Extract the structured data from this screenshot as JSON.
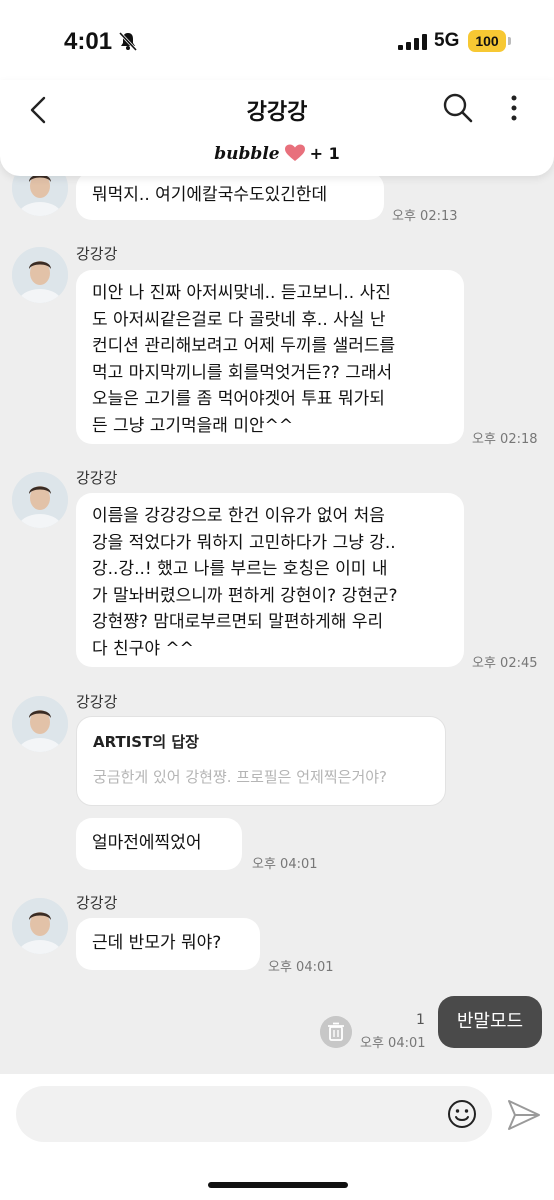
{
  "status": {
    "time": "4:01",
    "network": "5G",
    "battery": "100"
  },
  "header": {
    "title": "강강강",
    "bubble_logo": "bubble",
    "bubble_count": "+ 1"
  },
  "messages": [
    {
      "text": "뭐먹지.. 여기에칼국수도있긴한데",
      "time": "오후 02:13"
    },
    {
      "sender": "강강강",
      "lines": [
        "미안 나 진짜 아저씨맞네.. 듣고보니.. 사진",
        "도 아저씨같은걸로 다 골랏네 후.. 사실 난",
        "컨디션 관리해보려고 어제 두끼를 샐러드를",
        "먹고 마지막끼니를 회를먹엇거든?? 그래서",
        "오늘은 고기를 좀 먹어야겟어 투표 뭐가되",
        "든 그냥 고기먹을래 미안^^"
      ],
      "time": "오후 02:18"
    },
    {
      "sender": "강강강",
      "lines": [
        "이름을 강강강으로 한건 이유가 없어 처음",
        "강을 적었다가 뭐하지 고민하다가 그냥 강..",
        "강..강..! 했고 나를 부르는 호칭은 이미 내",
        "가 말놔버렸으니까 편하게 강현이? 강현군?",
        "강현쨩? 맘대로부르면되 말편하게해 우리",
        "다 친구야 ^^"
      ],
      "time": "오후 02:45"
    },
    {
      "sender": "강강강",
      "reply_title": "ARTIST의 답장",
      "reply_quote": "궁금한게 있어 강현쨩. 프로필은 언제찍은거야?",
      "text": "얼마전에찍었어",
      "time": "오후 04:01"
    },
    {
      "sender": "강강강",
      "text": "근데 반모가 뭐야?",
      "time": "오후 04:01"
    }
  ],
  "my_message": {
    "text": "반말모드",
    "unread": "1",
    "time": "오후 04:01"
  },
  "input": {
    "placeholder": ""
  },
  "colors": {
    "background": "#eeeeee",
    "bubble": "#ffffff",
    "my_bubble": "#4a4a4a",
    "battery": "#f7c833",
    "heart": "#e8707c"
  }
}
